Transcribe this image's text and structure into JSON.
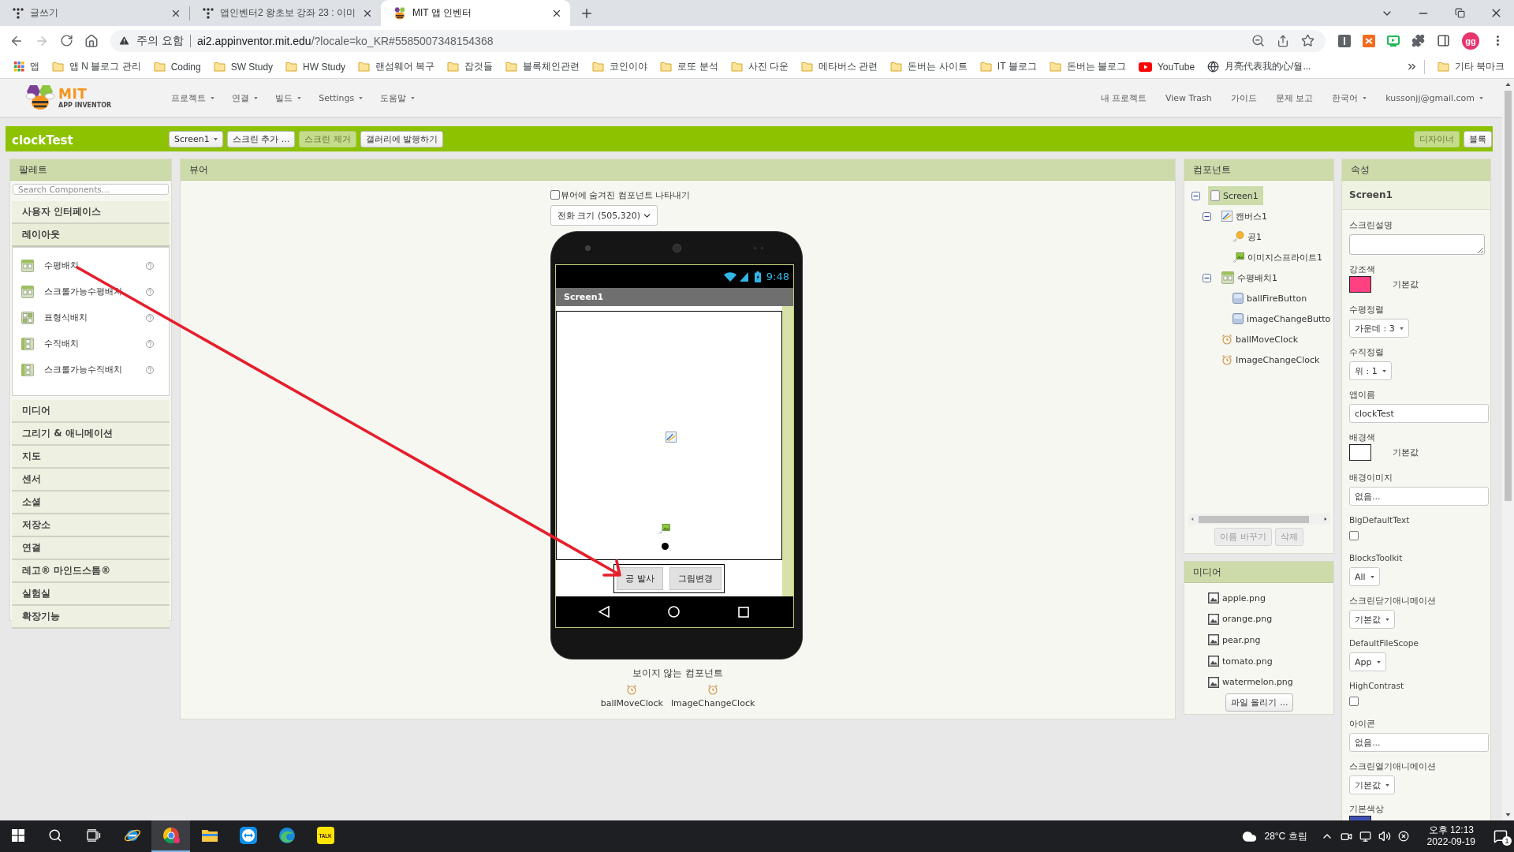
{
  "browser": {
    "tabs": [
      {
        "title": "글쓰기",
        "kind": "dots",
        "selected": false
      },
      {
        "title": "앱인벤터2 왕초보 강좌 23 : 이미",
        "kind": "dots",
        "selected": false
      },
      {
        "title": "MIT 앱 인벤터",
        "kind": "hexagons",
        "selected": true
      }
    ],
    "forward": {
      "disabled": true
    },
    "address": {
      "warning": "주의 요함",
      "host": "ai2.appinventor.mit.edu",
      "path": "/?locale=ko_KR#5585007348154368"
    },
    "profile": "gg",
    "bookmarks": [
      {
        "label": "앱",
        "kind": "apps"
      },
      {
        "label": "앱 N 블로그 관리",
        "kind": "folder"
      },
      {
        "label": "Coding",
        "kind": "folder"
      },
      {
        "label": "SW Study",
        "kind": "folder"
      },
      {
        "label": "HW Study",
        "kind": "folder"
      },
      {
        "label": "랜섬웨어 복구",
        "kind": "folder"
      },
      {
        "label": "잡것들",
        "kind": "folder"
      },
      {
        "label": "블록체인관련",
        "kind": "folder"
      },
      {
        "label": "코인이야",
        "kind": "folder"
      },
      {
        "label": "로또 분석",
        "kind": "folder"
      },
      {
        "label": "사진 다운",
        "kind": "folder"
      },
      {
        "label": "메타버스 관련",
        "kind": "folder"
      },
      {
        "label": "돈버는 사이트",
        "kind": "folder"
      },
      {
        "label": "IT 블로그",
        "kind": "folder"
      },
      {
        "label": "돈버는 블로그",
        "kind": "folder"
      },
      {
        "label": "YouTube",
        "kind": "video"
      },
      {
        "label": "月亮代表我的心/월...",
        "kind": "site"
      }
    ],
    "other_bookmarks": "기타 북마크"
  },
  "app": {
    "logo": {
      "title": "MIT",
      "subtitle": "APP INVENTOR"
    },
    "menus": [
      "프로젝트",
      "연결",
      "빌드",
      "Settings",
      "도움말"
    ],
    "links": [
      {
        "label": "내 프로젝트",
        "dropdown": false
      },
      {
        "label": "View Trash",
        "dropdown": false
      },
      {
        "label": "가이드",
        "dropdown": false
      },
      {
        "label": "문제 보고",
        "dropdown": false
      },
      {
        "label": "한국어",
        "dropdown": true
      },
      {
        "label": "kussonjj@gmail.com",
        "dropdown": true
      }
    ]
  },
  "project_bar": {
    "title": "clockTest",
    "screen": "Screen1",
    "actions": [
      {
        "label": "스크린 추가 ...",
        "disabled": false
      },
      {
        "label": "스크린 제거",
        "disabled": true
      },
      {
        "label": "갤러리에 발행하기",
        "disabled": false
      }
    ],
    "views": [
      {
        "label": "디자이너",
        "selected": true
      },
      {
        "label": "블록",
        "selected": false
      }
    ]
  },
  "palette": {
    "title": "팔레트",
    "placeholder": "Search Components...",
    "categories": [
      {
        "label": "사용자 인터페이스",
        "expanded": false
      },
      {
        "label": "레이아웃",
        "expanded": true,
        "items": [
          {
            "label": "수평배치",
            "kind": "horizontal"
          },
          {
            "label": "스크롤가능수평배치",
            "kind": "horizontal"
          },
          {
            "label": "표형식배치",
            "kind": "table"
          },
          {
            "label": "수직배치",
            "kind": "vertical"
          },
          {
            "label": "스크롤가능수직배치",
            "kind": "vertical"
          }
        ]
      },
      {
        "label": "미디어",
        "expanded": false
      },
      {
        "label": "그리기 & 애니메이션",
        "expanded": false
      },
      {
        "label": "지도",
        "expanded": false
      },
      {
        "label": "센서",
        "expanded": false
      },
      {
        "label": "소셜",
        "expanded": false
      },
      {
        "label": "저장소",
        "expanded": false
      },
      {
        "label": "연결",
        "expanded": false
      },
      {
        "label": "레고® 마인드스톰®",
        "expanded": false
      },
      {
        "label": "실험실",
        "expanded": false
      },
      {
        "label": "확장기능",
        "expanded": false
      }
    ]
  },
  "viewer": {
    "title": "뷰어",
    "show_hidden": {
      "label": "뷰어에 숨겨진 컴포넌트 나타내기",
      "checked": false
    },
    "phone_size": "전화 크기 (505,320)",
    "phone": {
      "time": "9:48",
      "screen_title": "Screen1",
      "buttons": [
        "공 발사",
        "그림변경"
      ]
    },
    "nonvisible": {
      "title": "보이지 않는 컴포넌트",
      "items": [
        "ballMoveClock",
        "ImageChangeClock"
      ]
    }
  },
  "components": {
    "title": "컴포넌트",
    "tree": [
      {
        "label": "Screen1",
        "kind": "screen",
        "selected": true,
        "expanded": true,
        "children": [
          {
            "label": "캔버스1",
            "kind": "canvas",
            "selected": false,
            "expanded": true,
            "children": [
              {
                "label": "공1",
                "kind": "ball",
                "selected": false
              },
              {
                "label": "이미지스프라이트1",
                "kind": "sprite",
                "selected": false
              }
            ]
          },
          {
            "label": "수평배치1",
            "kind": "arrangement",
            "selected": false,
            "expanded": true,
            "children": [
              {
                "label": "ballFireButton",
                "kind": "button",
                "selected": false
              },
              {
                "label": "imageChangeButto",
                "kind": "button",
                "selected": false
              }
            ]
          },
          {
            "label": "ballMoveClock",
            "kind": "clock",
            "selected": false
          },
          {
            "label": "ImageChangeClock",
            "kind": "clock",
            "selected": false
          }
        ]
      }
    ],
    "buttons": [
      {
        "label": "이름 바꾸기",
        "disabled": true
      },
      {
        "label": "삭제",
        "disabled": true
      }
    ]
  },
  "media": {
    "title": "미디어",
    "files": [
      "apple.png",
      "orange.png",
      "pear.png",
      "tomato.png",
      "watermelon.png"
    ],
    "upload": "파일 올리기 ..."
  },
  "properties": {
    "title": "속성",
    "component": "Screen1",
    "items": [
      {
        "label": "스크린설명",
        "kind": "textarea"
      },
      {
        "label": "강조색",
        "kind": "color",
        "color": "#ff4081",
        "value": "기본값"
      },
      {
        "label": "수평정렬",
        "kind": "select",
        "value": "가운데 : 3"
      },
      {
        "label": "수직정렬",
        "kind": "select",
        "value": "위 : 1"
      },
      {
        "label": "앱이름",
        "kind": "text",
        "value": "clockTest"
      },
      {
        "label": "배경색",
        "kind": "color",
        "color": "#ffffff",
        "value": "기본값"
      },
      {
        "label": "배경이미지",
        "kind": "text",
        "value": "없음..."
      },
      {
        "label": "BigDefaultText",
        "kind": "checkbox",
        "checked": false
      },
      {
        "label": "BlocksToolkit",
        "kind": "select",
        "value": "All"
      },
      {
        "label": "스크린닫기애니메이션",
        "kind": "select",
        "value": "기본값"
      },
      {
        "label": "DefaultFileScope",
        "kind": "select",
        "value": "App"
      },
      {
        "label": "HighContrast",
        "kind": "checkbox",
        "checked": false
      },
      {
        "label": "아이콘",
        "kind": "text",
        "value": "없음..."
      },
      {
        "label": "스크린열기애니메이션",
        "kind": "select",
        "value": "기본값"
      },
      {
        "label": "기본색상",
        "kind": "color",
        "color": "#3f51b5"
      }
    ]
  },
  "taskbar": {
    "apps": [
      {
        "kind": "ring",
        "active": false
      },
      {
        "kind": "round",
        "active": true
      },
      {
        "kind": "folder",
        "active": false
      },
      {
        "kind": "arrows",
        "active": false
      },
      {
        "kind": "swirl",
        "active": false
      },
      {
        "kind": "chat",
        "active": false,
        "label": "TALK"
      }
    ],
    "weather": "28°C 흐림",
    "time": "오후 12:13",
    "date": "2022-09-19",
    "notifications": "1"
  }
}
